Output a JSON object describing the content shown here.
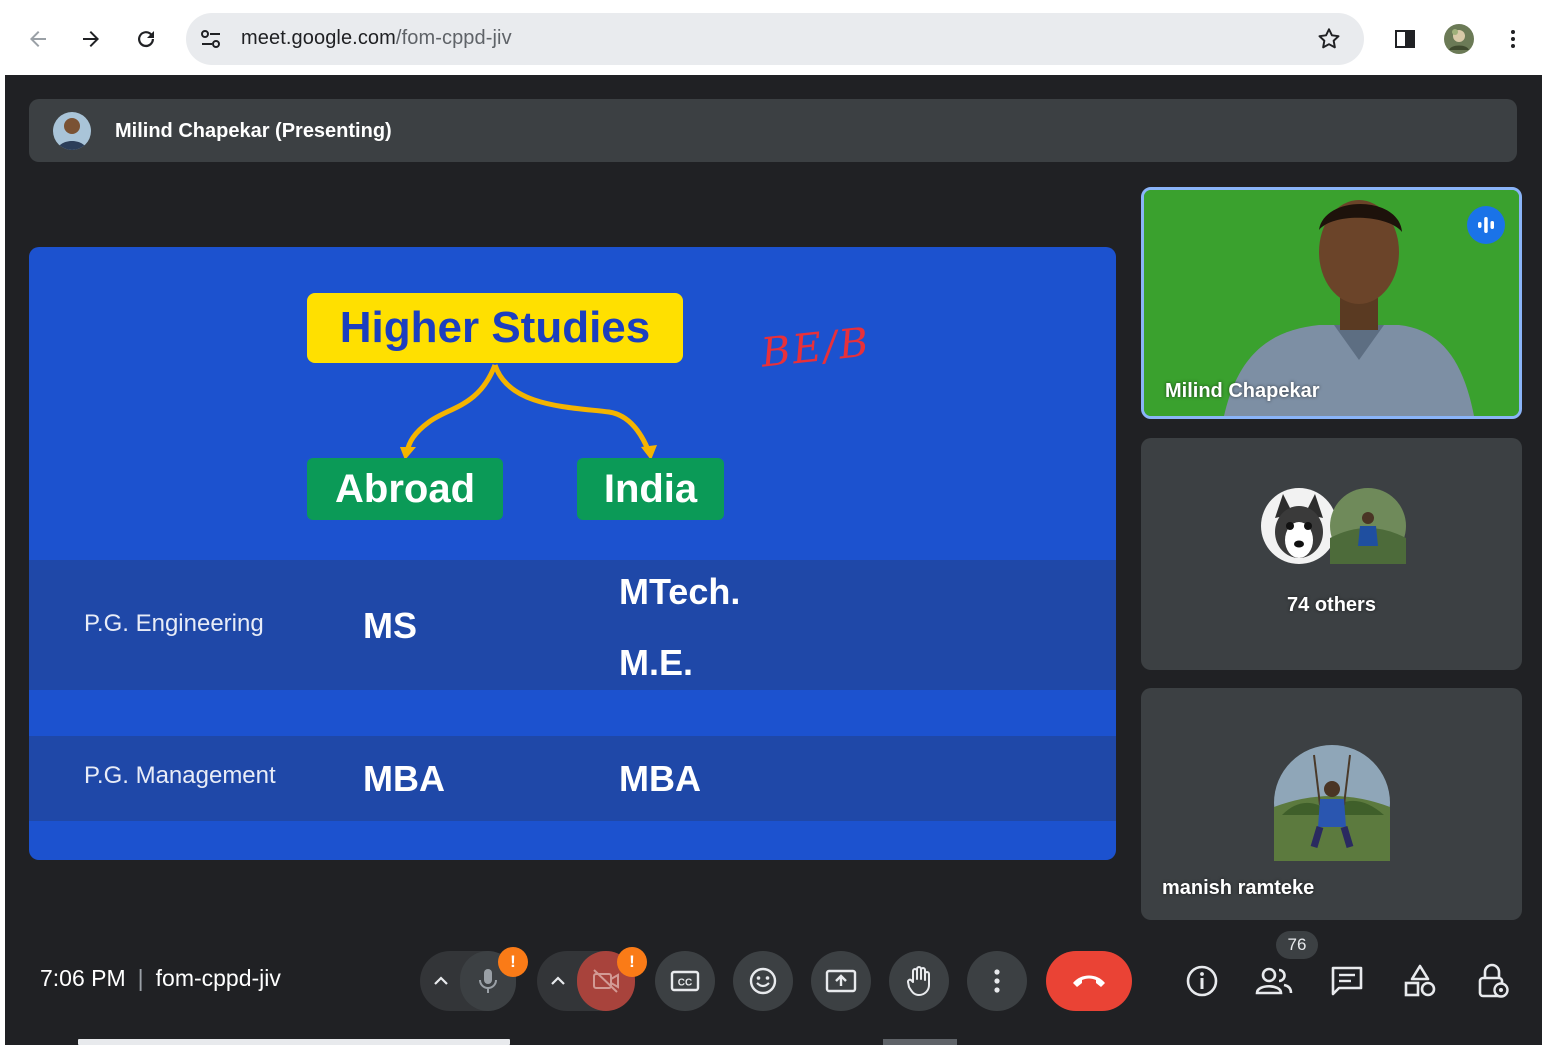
{
  "browser": {
    "url_host": "meet.google.com",
    "url_path": "/fom-cppd-jiv"
  },
  "presenter": {
    "label": "Milind Chapekar (Presenting)"
  },
  "slide": {
    "title": "Higher Studies",
    "branch_left": "Abroad",
    "branch_right": "India",
    "annotation": "BE/B",
    "rows": [
      {
        "label": "P.G. Engineering",
        "abroad": "MS",
        "india_1": "MTech.",
        "india_2": "M.E."
      },
      {
        "label": "P.G. Management",
        "abroad": "MBA",
        "india_1": "MBA"
      }
    ]
  },
  "tiles": {
    "main_name": "Milind Chapekar",
    "others_label": "74 others",
    "third_name": "manish ramteke"
  },
  "bottom_bar": {
    "time": "7:06 PM",
    "meeting_code": "fom-cppd-jiv",
    "participant_count": "76",
    "mic_badge": "!",
    "cam_badge": "!"
  },
  "colors": {
    "meet_bg": "#202124",
    "slide_bg": "#1c52cf",
    "title_box": "#ffe000",
    "branch_box": "#0b9a57",
    "end_call": "#ea4335",
    "accent": "#8ab4f8"
  }
}
